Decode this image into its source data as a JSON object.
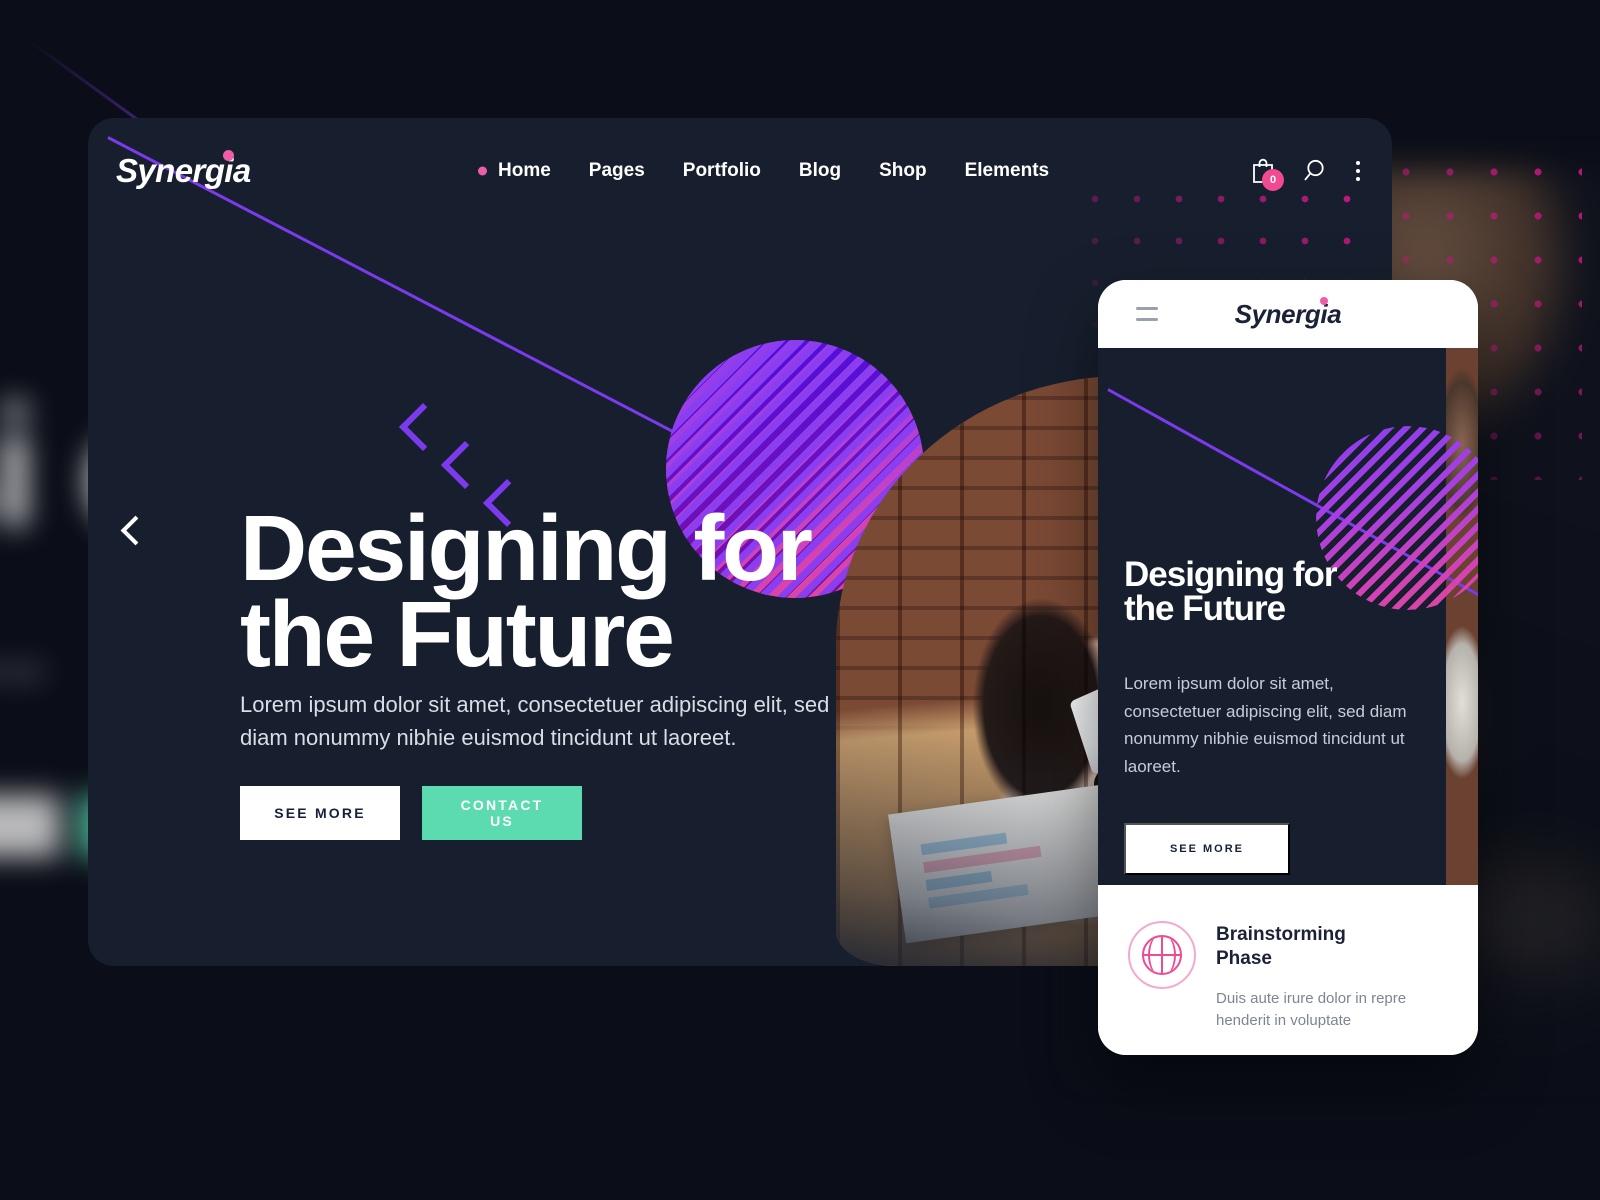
{
  "brand": {
    "name": "Synergia"
  },
  "colors": {
    "card_bg": "#171f2e",
    "page_bg": "#0b0e18",
    "accent_pink": "#ef5da8",
    "accent_purple": "#7c3aed",
    "accent_mint": "#5ddbb0",
    "accent_magenta": "#c2187f"
  },
  "nav": {
    "items": [
      {
        "label": "Home",
        "active": true
      },
      {
        "label": "Pages",
        "active": false
      },
      {
        "label": "Portfolio",
        "active": false
      },
      {
        "label": "Blog",
        "active": false
      },
      {
        "label": "Shop",
        "active": false
      },
      {
        "label": "Elements",
        "active": false
      }
    ]
  },
  "toolbar": {
    "cart_icon": "shopping-bag-icon",
    "cart_count": "0",
    "search_icon": "search-icon",
    "menu_icon": "kebab-menu-icon"
  },
  "hero": {
    "title_line1": "Designing for",
    "title_line2": "the Future",
    "paragraph": "Lorem ipsum dolor sit amet, consectetuer adipiscing elit, sed diam nonummy nibhie euismod tincidunt ut laoreet.",
    "btn_primary": "SEE MORE",
    "btn_secondary": "CONTACT US",
    "prev_arrow_icon": "chevron-left-icon"
  },
  "mobile": {
    "menu_icon": "hamburger-menu-icon",
    "logo": "Synergia",
    "title_line1": "Designing for",
    "title_line2": "the Future",
    "paragraph": "Lorem ipsum dolor sit amet, consectetuer adipiscing elit, sed diam nonummy nibhie euismod tincidunt ut laoreet.",
    "btn_primary": "SEE MORE",
    "feature": {
      "icon": "brainstorm-sphere-icon",
      "title": "Brainstorming Phase",
      "description": "Duis aute irure dolor in repre henderit in voluptate"
    }
  },
  "background_preview": {
    "title_fragment": "si e",
    "paragraph_fragment": "dolor s hie eui"
  }
}
